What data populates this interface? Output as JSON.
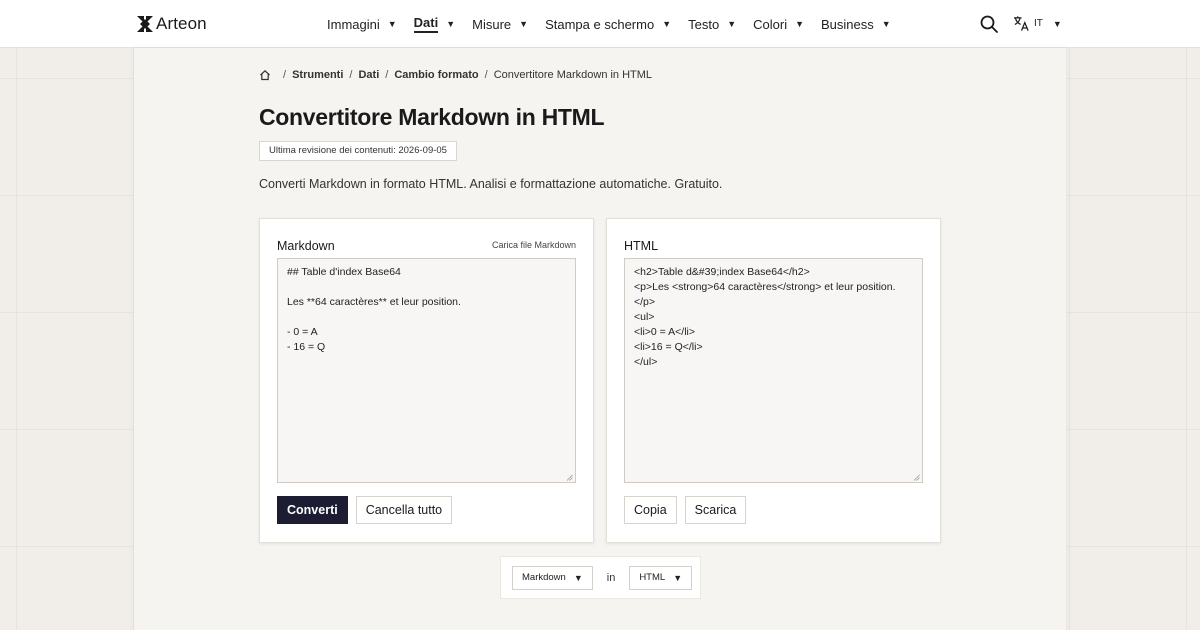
{
  "header": {
    "brand": "Arteon",
    "nav": [
      {
        "label": "Immagini",
        "active": false
      },
      {
        "label": "Dati",
        "active": true
      },
      {
        "label": "Misure",
        "active": false
      },
      {
        "label": "Stampa e schermo",
        "active": false
      },
      {
        "label": "Testo",
        "active": false
      },
      {
        "label": "Colori",
        "active": false
      },
      {
        "label": "Business",
        "active": false
      }
    ],
    "lang_code": "IT"
  },
  "breadcrumb": {
    "items": [
      "Strumenti",
      "Dati",
      "Cambio formato"
    ],
    "current": "Convertitore Markdown in HTML"
  },
  "page": {
    "title": "Convertitore Markdown in HTML",
    "revision": "Ultima revisione dei contenuti: 2026-09-05",
    "subtitle": "Converti Markdown in formato HTML. Analisi e formattazione automatiche. Gratuito."
  },
  "input_panel": {
    "title": "Markdown",
    "upload_label": "Carica file Markdown",
    "value": "## Table d'index Base64\n\nLes **64 caractères** et leur position.\n\n- 0 = A\n- 16 = Q",
    "convert_label": "Converti",
    "clear_label": "Cancella tutto"
  },
  "output_panel": {
    "title": "HTML",
    "value": "<h2>Table d&#39;index Base64</h2>\n<p>Les <strong>64 caractères</strong> et leur position.</p>\n<ul>\n<li>0 = A</li>\n<li>16 = Q</li>\n</ul>",
    "copy_label": "Copia",
    "download_label": "Scarica"
  },
  "format_bar": {
    "from": "Markdown",
    "in_label": "in",
    "to": "HTML"
  },
  "colors": {
    "primary_button": "#1c1d33",
    "page_background": "#f1ede8",
    "card_background": "#f6f4f1"
  },
  "icons": {
    "logo": "arteon-logo-icon",
    "search": "search-icon",
    "language": "translate-icon",
    "home": "home-icon"
  }
}
